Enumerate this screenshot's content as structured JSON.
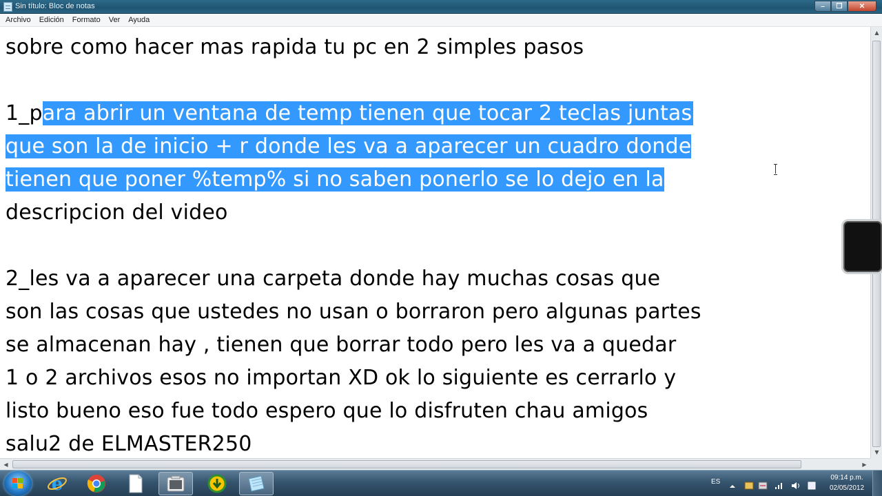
{
  "window": {
    "title": "Sin título: Bloc de notas"
  },
  "menu": {
    "items": [
      "Archivo",
      "Edición",
      "Formato",
      "Ver",
      "Ayuda"
    ]
  },
  "document": {
    "lines": [
      {
        "pre": "sobre como hacer mas rapida tu pc en 2 simples pasos",
        "sel": "",
        "post": ""
      },
      {
        "pre": "",
        "sel": "",
        "post": ""
      },
      {
        "pre": "1_p",
        "sel": "ara abrir un ventana de temp tienen que tocar 2 teclas juntas",
        "post": ""
      },
      {
        "pre": "",
        "sel": "que son la de inicio + r donde les va a aparecer un cuadro donde",
        "post": ""
      },
      {
        "pre": "",
        "sel": "tienen que poner %temp% si no saben ponerlo se lo dejo en la",
        "post": ""
      },
      {
        "pre": "descripcion del video",
        "sel": "",
        "post": ""
      },
      {
        "pre": "",
        "sel": "",
        "post": ""
      },
      {
        "pre": "2_les va a aparecer una carpeta donde hay muchas cosas que",
        "sel": "",
        "post": ""
      },
      {
        "pre": "son las cosas que ustedes no usan o borraron pero algunas partes",
        "sel": "",
        "post": ""
      },
      {
        "pre": "se almacenan hay , tienen que borrar todo pero les va a quedar",
        "sel": "",
        "post": ""
      },
      {
        "pre": "1 o 2 archivos esos no importan XD ok lo siguiente es cerrarlo y",
        "sel": "",
        "post": ""
      },
      {
        "pre": "listo bueno eso fue todo espero que lo disfruten chau amigos",
        "sel": "",
        "post": ""
      },
      {
        "pre": "salu2 de ELMASTER250",
        "sel": "",
        "post": ""
      }
    ]
  },
  "taskbar": {
    "language": "ES",
    "time": "09:14 p.m.",
    "date": "02/05/2012",
    "apps": [
      {
        "icon": "internet-explorer-icon"
      },
      {
        "icon": "chrome-icon"
      },
      {
        "icon": "blank-document-icon"
      },
      {
        "icon": "explorer-folder-icon"
      },
      {
        "icon": "download-manager-icon"
      },
      {
        "icon": "notepad-icon"
      }
    ]
  },
  "colors": {
    "selection": "#3399ff",
    "selection_text": "#ffffff",
    "editor_bg": "#ffffff"
  }
}
